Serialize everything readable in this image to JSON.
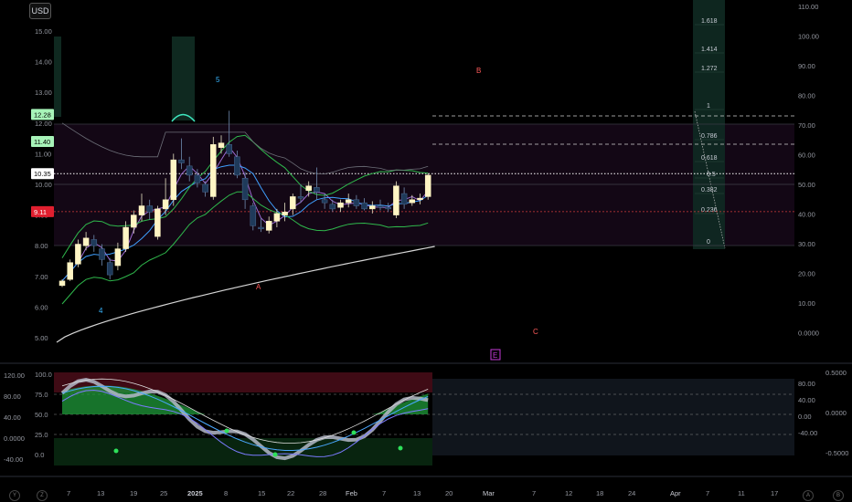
{
  "toolbar": {
    "currency": "USD"
  },
  "colors": {
    "candle_up": "#fff5c4",
    "candle_down": "#1f3a5a",
    "ma_fast": "#9b6bd1",
    "ma_mid": "#3fa0ff",
    "env_green": "#2fb84c",
    "ma_slow": "#d6d6d6",
    "fib_text": "#c9cdd6",
    "red_line": "#d23b3b",
    "label_green": "#a7f3b8"
  },
  "chart_data": [
    {
      "type": "candlestick",
      "price_axis_left": [
        "15.00",
        "14.00",
        "13.00",
        "12.00",
        "11.00",
        "10.00",
        "9.00",
        "8.00",
        "7.00",
        "6.00",
        "5.00"
      ],
      "percent_axis_right": [
        "110.00",
        "100.00",
        "90.00",
        "80.00",
        "70.00",
        "60.00",
        "50.00",
        "40.00",
        "30.00",
        "20.00",
        "10.00",
        "0.0000"
      ],
      "price_labels": [
        {
          "text": "12.28",
          "value": 12.28,
          "role": "green"
        },
        {
          "text": "11.40",
          "value": 11.4,
          "role": "green"
        },
        {
          "text": "10.35",
          "value": 10.35,
          "role": "current"
        },
        {
          "text": "9.11",
          "value": 9.11,
          "role": "red"
        }
      ],
      "x_ticks": [
        "7",
        "13",
        "19",
        "25",
        "2025",
        "8",
        "15",
        "22",
        "28",
        "Feb",
        "7",
        "13",
        "20",
        "Mar",
        "7",
        "12",
        "18",
        "24",
        "Apr",
        "7",
        "11",
        "17"
      ],
      "fib_levels": [
        "1.618",
        "1.414",
        "1.272",
        "1",
        "0.786",
        "0.618",
        "0.5",
        "0.382",
        "0.236",
        "0"
      ],
      "wave_labels": [
        "5",
        "4",
        "A",
        "B",
        "C",
        "E"
      ],
      "candles": [
        [
          6.7,
          6.9,
          6.65,
          6.85
        ],
        [
          6.9,
          7.55,
          6.85,
          7.45
        ],
        [
          7.4,
          8.2,
          7.3,
          8.05
        ],
        [
          8.0,
          8.45,
          7.85,
          8.25
        ],
        [
          8.2,
          8.35,
          7.8,
          8.0
        ],
        [
          7.9,
          8.05,
          7.35,
          7.55
        ],
        [
          7.45,
          7.6,
          6.9,
          7.05
        ],
        [
          7.35,
          8.1,
          7.2,
          7.9
        ],
        [
          7.9,
          8.8,
          7.8,
          8.6
        ],
        [
          8.6,
          9.15,
          8.4,
          9.0
        ],
        [
          9.0,
          9.7,
          8.8,
          9.3
        ],
        [
          9.3,
          9.5,
          8.85,
          9.1
        ],
        [
          8.3,
          9.3,
          8.2,
          9.2
        ],
        [
          9.2,
          10.2,
          9.0,
          9.5
        ],
        [
          9.5,
          11.0,
          9.3,
          10.8
        ],
        [
          10.8,
          11.5,
          10.5,
          10.7
        ],
        [
          10.6,
          10.9,
          10.1,
          10.3
        ],
        [
          10.3,
          10.5,
          9.9,
          10.05
        ],
        [
          10.0,
          10.1,
          9.6,
          9.75
        ],
        [
          9.6,
          11.55,
          9.5,
          11.3
        ],
        [
          11.2,
          11.6,
          11.0,
          11.35
        ],
        [
          11.3,
          12.4,
          10.9,
          11.0
        ],
        [
          10.9,
          11.1,
          10.2,
          10.3
        ],
        [
          10.2,
          10.4,
          9.2,
          9.5
        ],
        [
          9.3,
          9.4,
          8.5,
          8.65
        ],
        [
          8.6,
          8.9,
          8.45,
          8.55
        ],
        [
          8.5,
          8.95,
          8.4,
          8.8
        ],
        [
          8.8,
          9.2,
          8.6,
          9.05
        ],
        [
          9.0,
          9.4,
          8.8,
          9.1
        ],
        [
          9.2,
          9.7,
          9.0,
          9.6
        ],
        [
          9.6,
          10.0,
          9.4,
          9.55
        ],
        [
          9.8,
          10.1,
          9.6,
          9.95
        ],
        [
          9.9,
          10.55,
          9.5,
          9.75
        ],
        [
          9.5,
          9.7,
          9.2,
          9.4
        ],
        [
          9.35,
          9.5,
          9.1,
          9.2
        ],
        [
          9.25,
          9.5,
          9.1,
          9.4
        ],
        [
          9.4,
          9.7,
          9.25,
          9.5
        ],
        [
          9.5,
          9.65,
          9.2,
          9.3
        ],
        [
          9.4,
          9.55,
          9.15,
          9.2
        ],
        [
          9.2,
          9.45,
          9.05,
          9.3
        ],
        [
          9.3,
          9.5,
          9.15,
          9.25
        ],
        [
          9.25,
          9.4,
          9.1,
          9.2
        ],
        [
          9.0,
          10.1,
          8.9,
          9.95
        ],
        [
          9.7,
          9.9,
          9.2,
          9.35
        ],
        [
          9.4,
          9.65,
          9.3,
          9.5
        ],
        [
          9.5,
          9.7,
          9.35,
          9.55
        ],
        [
          9.6,
          10.35,
          9.5,
          10.3
        ]
      ]
    },
    {
      "type": "oscillator",
      "left_axis": [
        "120.00",
        "80.00",
        "40.00",
        "0.0000",
        "-40.00"
      ],
      "inner_axis": [
        "100.0",
        "75.0",
        "50.0",
        "25.0",
        "0.0"
      ],
      "right_axis": [
        "80.00",
        "40.00",
        "0.00",
        "-40.00"
      ],
      "far_right_axis": [
        "0.5000",
        "0.0000",
        "-0.5000"
      ]
    }
  ],
  "bottom_bar": {
    "left_letters": [
      "Y",
      "Z"
    ],
    "right_letters": [
      "A",
      "B"
    ]
  }
}
